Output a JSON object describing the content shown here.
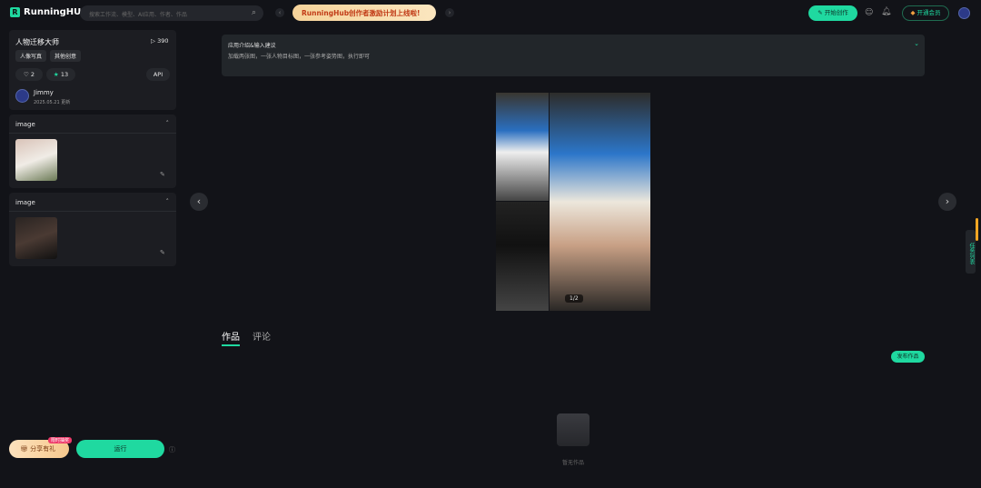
{
  "header": {
    "logo": "RunningHUB",
    "search_placeholder": "搜索工作流、模型、AI应用、作者、作品",
    "banner": "RunningHub创作者激励计划上线啦!",
    "create_button": "开始创作",
    "vip_button": "开通会员"
  },
  "app": {
    "title": "人物迁移大师",
    "runs": "390",
    "tags": [
      "人像写真",
      "其他创意"
    ],
    "likes": "2",
    "stars": "13",
    "api": "API",
    "author": "Jimmy",
    "updated": "2025.05.21 更新"
  },
  "inputs": [
    {
      "label": "image"
    },
    {
      "label": "image"
    }
  ],
  "info": {
    "title": "应用介绍&输入建议",
    "text": "加载两张图，一张人物目标图，一张参考姿势图，执行即可"
  },
  "gallery": {
    "counter": "1/2"
  },
  "tabs": [
    "作品",
    "评论"
  ],
  "publish_button": "发布作品",
  "empty_text": "暂无作品",
  "bottom": {
    "share": "分享有礼",
    "share_badge": "限时抽奖",
    "run": "运行"
  },
  "side_tab": "任务列表"
}
